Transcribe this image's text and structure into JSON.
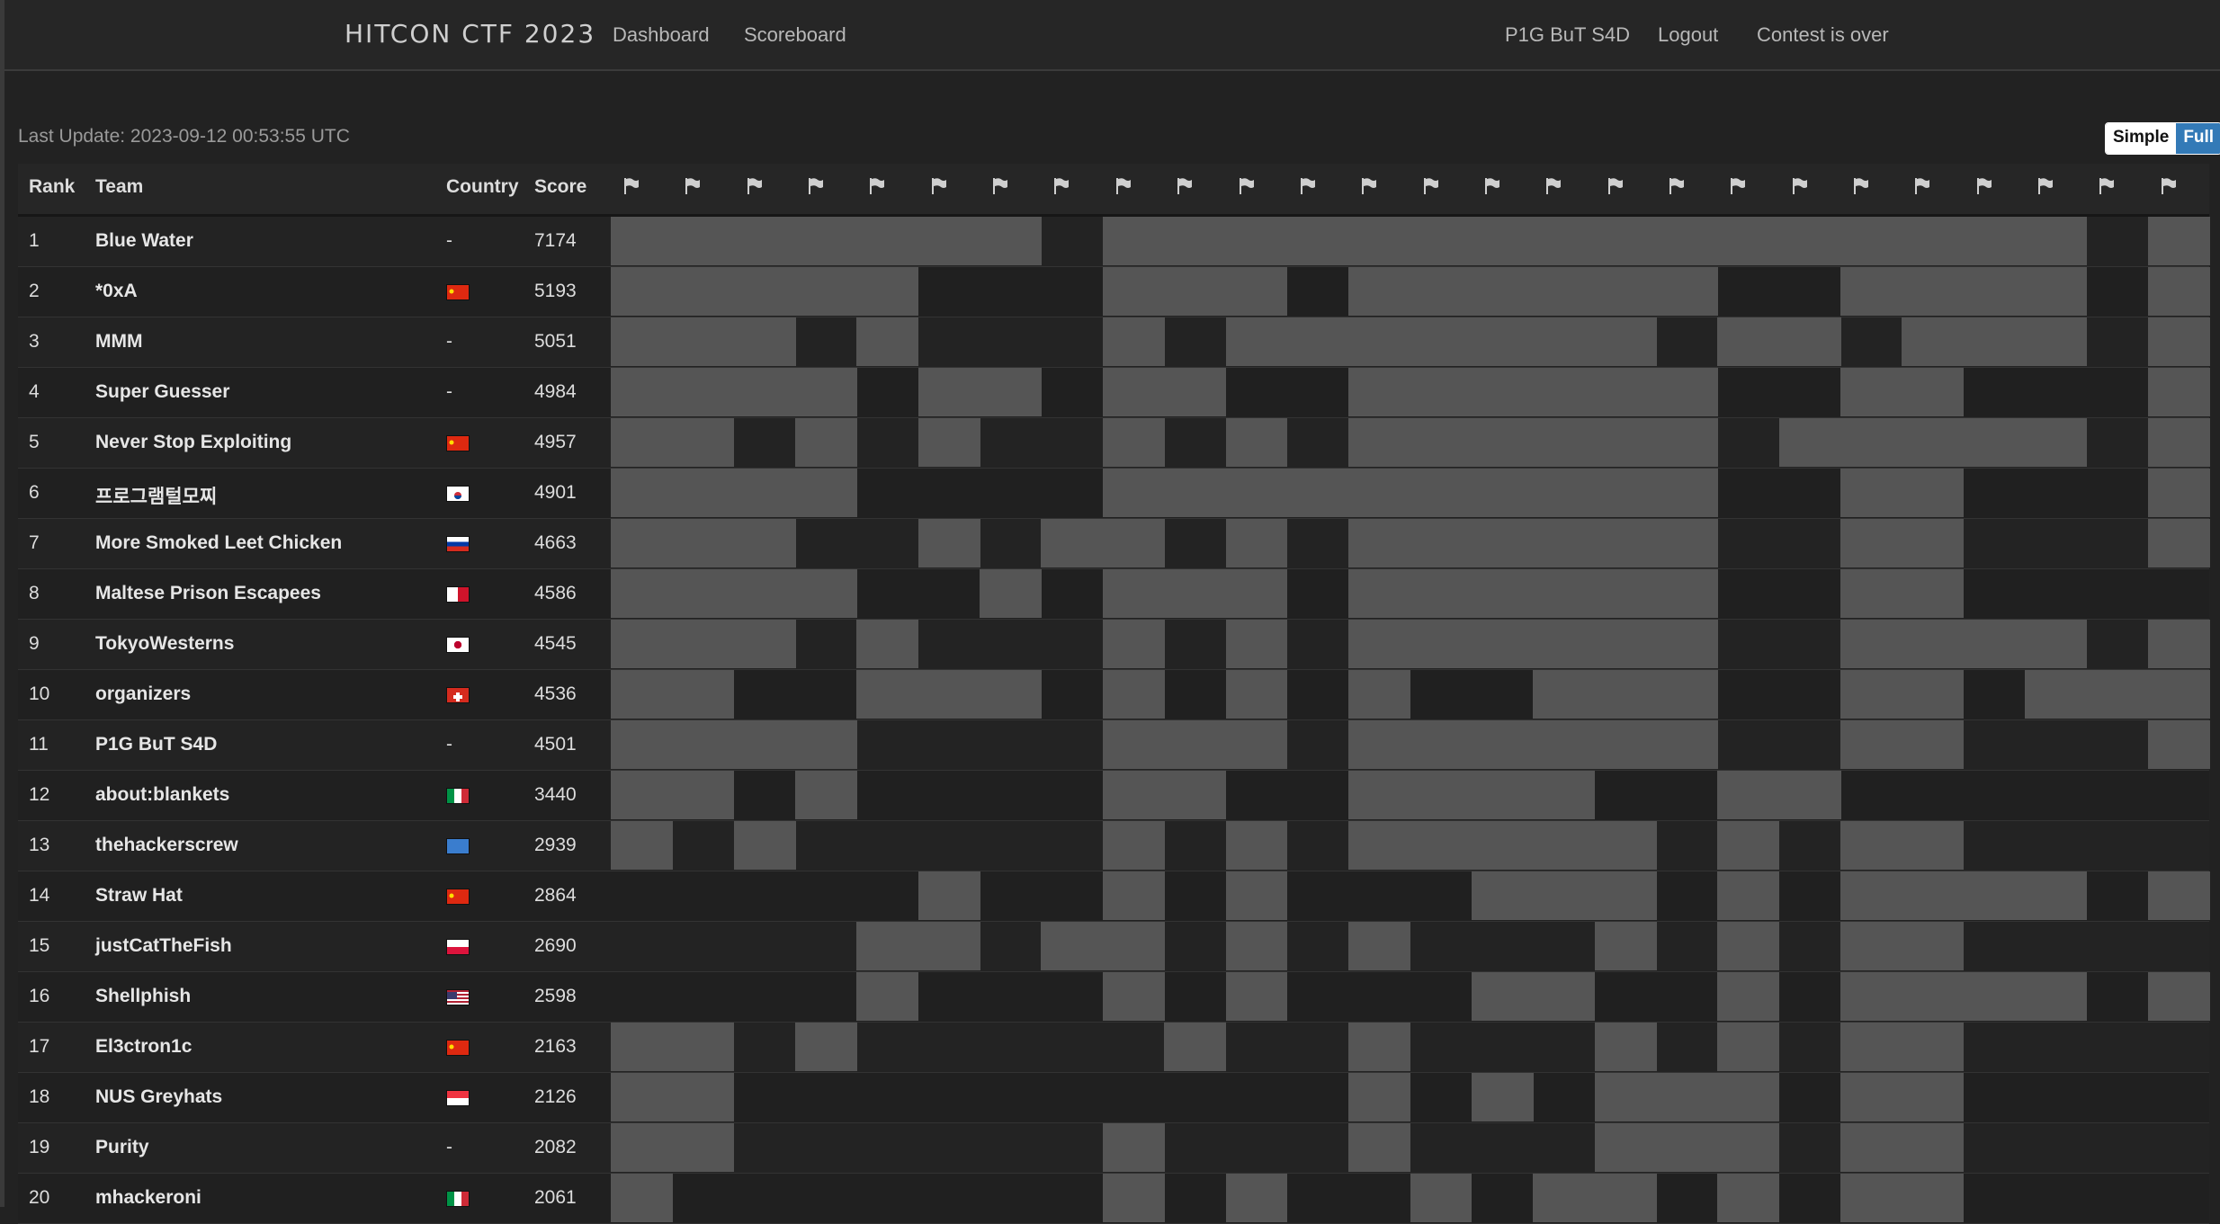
{
  "navbar": {
    "brand": "HITCON CTF 2023",
    "dashboard": "Dashboard",
    "scoreboard": "Scoreboard",
    "team": "P1G BuT S4D",
    "logout": "Logout",
    "status": "Contest is over"
  },
  "last_update": "Last Update: 2023-09-12 00:53:55 UTC",
  "toggle": {
    "simple": "Simple",
    "full": "Full"
  },
  "columns": {
    "rank": "Rank",
    "team": "Team",
    "country": "Country",
    "score": "Score"
  },
  "challenge_count": 26,
  "colors": {
    "solved": "#555555",
    "unsolved": "#222222",
    "accent": "#337ab7"
  },
  "rows": [
    {
      "rank": "1",
      "team": "Blue Water",
      "country": "-",
      "score": "7174",
      "solved": [
        1,
        1,
        1,
        1,
        1,
        1,
        1,
        0,
        1,
        1,
        1,
        1,
        1,
        1,
        1,
        1,
        1,
        1,
        1,
        1,
        1,
        1,
        1,
        1,
        0,
        1
      ]
    },
    {
      "rank": "2",
      "team": "*0xA",
      "country": "cn",
      "score": "5193",
      "solved": [
        1,
        1,
        1,
        1,
        1,
        0,
        0,
        0,
        1,
        1,
        1,
        0,
        1,
        1,
        1,
        1,
        1,
        1,
        0,
        0,
        1,
        1,
        1,
        1,
        0,
        1
      ]
    },
    {
      "rank": "3",
      "team": "MMM",
      "country": "-",
      "score": "5051",
      "solved": [
        1,
        1,
        1,
        0,
        1,
        0,
        0,
        0,
        1,
        0,
        1,
        1,
        1,
        1,
        1,
        1,
        1,
        0,
        1,
        1,
        0,
        1,
        1,
        1,
        0,
        1
      ]
    },
    {
      "rank": "4",
      "team": "Super Guesser",
      "country": "-",
      "score": "4984",
      "solved": [
        1,
        1,
        1,
        1,
        0,
        1,
        1,
        0,
        1,
        1,
        0,
        0,
        1,
        1,
        1,
        1,
        1,
        1,
        0,
        0,
        1,
        1,
        0,
        0,
        0,
        1
      ]
    },
    {
      "rank": "5",
      "team": "Never Stop Exploiting",
      "country": "cn",
      "score": "4957",
      "solved": [
        1,
        1,
        0,
        1,
        0,
        1,
        0,
        0,
        1,
        0,
        1,
        0,
        1,
        1,
        1,
        1,
        1,
        1,
        0,
        1,
        1,
        1,
        1,
        1,
        0,
        1
      ]
    },
    {
      "rank": "6",
      "team": "프로그램털모찌",
      "country": "kr",
      "score": "4901",
      "solved": [
        1,
        1,
        1,
        1,
        0,
        0,
        0,
        0,
        1,
        1,
        1,
        1,
        1,
        1,
        1,
        1,
        1,
        1,
        0,
        0,
        1,
        1,
        0,
        0,
        0,
        1
      ]
    },
    {
      "rank": "7",
      "team": "More Smoked Leet Chicken",
      "country": "ru",
      "score": "4663",
      "solved": [
        1,
        1,
        1,
        0,
        0,
        1,
        0,
        1,
        1,
        0,
        1,
        0,
        1,
        1,
        1,
        1,
        1,
        1,
        0,
        0,
        1,
        1,
        0,
        0,
        0,
        1
      ]
    },
    {
      "rank": "8",
      "team": "Maltese Prison Escapees",
      "country": "mt",
      "score": "4586",
      "solved": [
        1,
        1,
        1,
        1,
        0,
        0,
        1,
        0,
        1,
        1,
        1,
        0,
        1,
        1,
        1,
        1,
        1,
        1,
        0,
        0,
        1,
        1,
        0,
        0,
        0,
        0
      ]
    },
    {
      "rank": "9",
      "team": "TokyoWesterns",
      "country": "jp",
      "score": "4545",
      "solved": [
        1,
        1,
        1,
        0,
        1,
        0,
        0,
        0,
        1,
        0,
        1,
        0,
        1,
        1,
        1,
        1,
        1,
        1,
        0,
        0,
        1,
        1,
        1,
        1,
        0,
        1
      ]
    },
    {
      "rank": "10",
      "team": "organizers",
      "country": "ch",
      "score": "4536",
      "solved": [
        1,
        1,
        0,
        0,
        1,
        1,
        1,
        0,
        1,
        0,
        1,
        0,
        1,
        0,
        0,
        1,
        1,
        1,
        0,
        0,
        1,
        1,
        0,
        1,
        1,
        1
      ]
    },
    {
      "rank": "11",
      "team": "P1G BuT S4D",
      "country": "-",
      "score": "4501",
      "solved": [
        1,
        1,
        1,
        1,
        0,
        0,
        0,
        0,
        1,
        1,
        1,
        0,
        1,
        1,
        1,
        1,
        1,
        1,
        0,
        0,
        1,
        1,
        0,
        0,
        0,
        1
      ]
    },
    {
      "rank": "12",
      "team": "about:blankets",
      "country": "it",
      "score": "3440",
      "solved": [
        1,
        1,
        0,
        1,
        0,
        0,
        0,
        0,
        1,
        1,
        0,
        0,
        1,
        1,
        1,
        1,
        0,
        0,
        1,
        1,
        0,
        0,
        0,
        0,
        0,
        0
      ]
    },
    {
      "rank": "13",
      "team": "thehackerscrew",
      "country": "aq",
      "score": "2939",
      "solved": [
        1,
        0,
        1,
        0,
        0,
        0,
        0,
        0,
        1,
        0,
        1,
        0,
        1,
        1,
        1,
        1,
        1,
        0,
        1,
        0,
        1,
        1,
        0,
        0,
        0,
        0
      ]
    },
    {
      "rank": "14",
      "team": "Straw Hat",
      "country": "cn",
      "score": "2864",
      "solved": [
        0,
        0,
        0,
        0,
        0,
        1,
        0,
        0,
        1,
        0,
        1,
        0,
        0,
        0,
        1,
        1,
        1,
        0,
        1,
        0,
        1,
        1,
        1,
        1,
        0,
        1
      ]
    },
    {
      "rank": "15",
      "team": "justCatTheFish",
      "country": "pl",
      "score": "2690",
      "solved": [
        0,
        0,
        0,
        0,
        1,
        1,
        0,
        1,
        1,
        0,
        1,
        0,
        1,
        0,
        0,
        0,
        1,
        0,
        1,
        0,
        1,
        1,
        0,
        0,
        0,
        0
      ]
    },
    {
      "rank": "16",
      "team": "Shellphish",
      "country": "us",
      "score": "2598",
      "solved": [
        0,
        0,
        0,
        0,
        1,
        0,
        0,
        0,
        1,
        0,
        1,
        0,
        0,
        0,
        1,
        1,
        0,
        0,
        1,
        0,
        1,
        1,
        1,
        1,
        0,
        1
      ]
    },
    {
      "rank": "17",
      "team": "El3ctron1c",
      "country": "cn",
      "score": "2163",
      "solved": [
        1,
        1,
        0,
        1,
        0,
        0,
        0,
        0,
        0,
        1,
        0,
        0,
        1,
        0,
        0,
        0,
        1,
        0,
        1,
        0,
        1,
        1,
        0,
        0,
        0,
        0
      ]
    },
    {
      "rank": "18",
      "team": "NUS Greyhats",
      "country": "sg",
      "score": "2126",
      "solved": [
        1,
        1,
        0,
        0,
        0,
        0,
        0,
        0,
        0,
        0,
        0,
        0,
        1,
        0,
        1,
        0,
        1,
        1,
        1,
        0,
        1,
        1,
        0,
        0,
        0,
        0
      ]
    },
    {
      "rank": "19",
      "team": "Purity",
      "country": "-",
      "score": "2082",
      "solved": [
        1,
        1,
        0,
        0,
        0,
        0,
        0,
        0,
        1,
        0,
        0,
        0,
        1,
        0,
        0,
        0,
        1,
        1,
        1,
        0,
        1,
        1,
        0,
        0,
        0,
        0
      ]
    },
    {
      "rank": "20",
      "team": "mhackeroni",
      "country": "it",
      "score": "2061",
      "solved": [
        1,
        0,
        0,
        0,
        0,
        0,
        0,
        0,
        1,
        0,
        1,
        0,
        0,
        1,
        0,
        1,
        1,
        0,
        1,
        0,
        1,
        1,
        0,
        0,
        0,
        0
      ]
    }
  ]
}
